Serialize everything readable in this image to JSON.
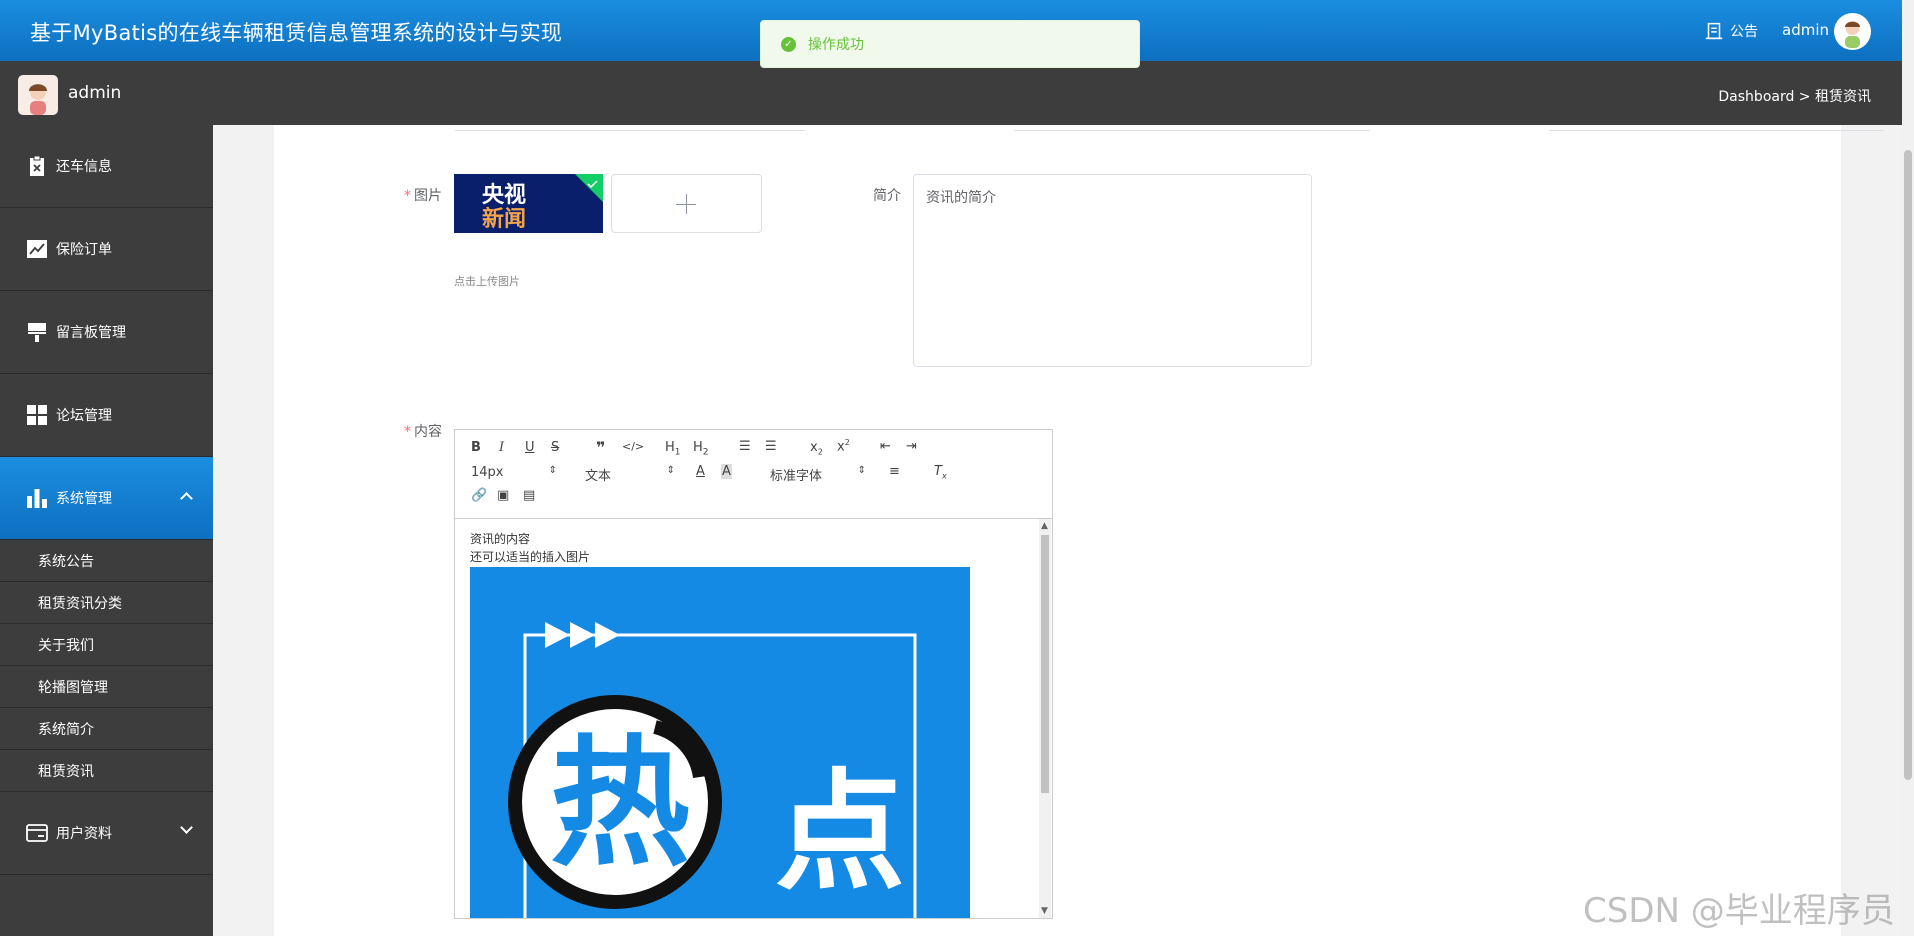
{
  "header": {
    "title": "基于MyBatis的在线车辆租赁信息管理系统的设计与实现",
    "notice_label": "公告",
    "user": "admin"
  },
  "subbar": {
    "user": "admin",
    "breadcrumb": "Dashboard > 租赁资讯"
  },
  "sidebar": {
    "items": [
      {
        "label": "还车信息",
        "icon": "clipboard-x-icon"
      },
      {
        "label": "保险订单",
        "icon": "trend-chart-icon"
      },
      {
        "label": "留言板管理",
        "icon": "brush-icon"
      },
      {
        "label": "论坛管理",
        "icon": "grid-icon"
      },
      {
        "label": "系统管理",
        "icon": "bar-chart-icon",
        "active": true,
        "expanded": true
      },
      {
        "label": "用户资料",
        "icon": "card-icon"
      }
    ],
    "sub_items": [
      "系统公告",
      "租赁资讯分类",
      "关于我们",
      "轮播图管理",
      "系统简介",
      "租赁资讯"
    ]
  },
  "form": {
    "image_label": "图片",
    "upload_hint": "点击上传图片",
    "thumb_text_1": "央视",
    "thumb_text_2": "新闻",
    "intro_label": "简介",
    "intro_placeholder": "资讯的简介",
    "content_label": "内容",
    "content_line1": "资讯的内容",
    "content_line2": "还可以适当的插入图片",
    "content_image_text1": "热",
    "content_image_text2": "点"
  },
  "editor": {
    "font_size": "14px",
    "block_type": "文本",
    "font_family": "标准字体"
  },
  "toast": {
    "message": "操作成功"
  },
  "watermark": "CSDN @毕业程序员",
  "colors": {
    "brand_blue": "#1b8ee0",
    "sidebar_dark": "#3d3d3d",
    "success_green": "#67c23a"
  }
}
